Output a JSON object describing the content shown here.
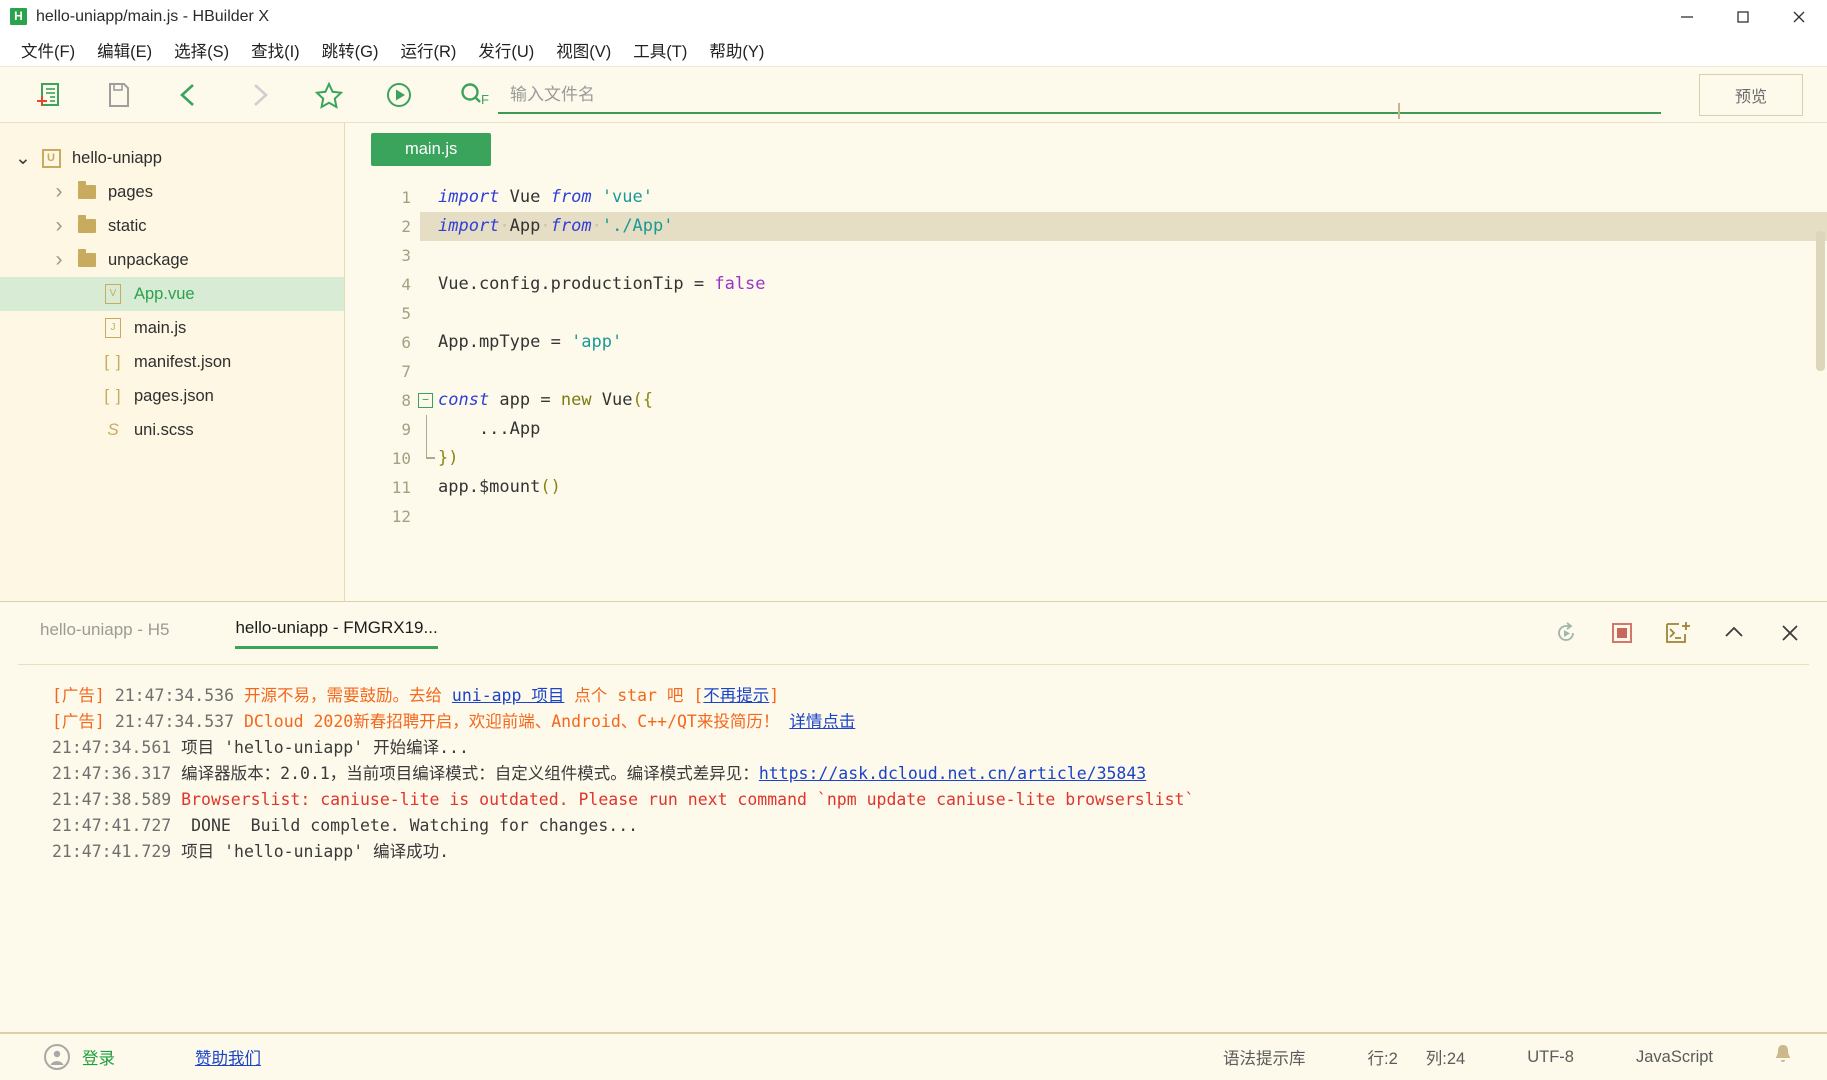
{
  "window": {
    "title": "hello-uniapp/main.js - HBuilder X",
    "logo_letter": "H",
    "minimize": "minimize-icon",
    "maximize": "maximize-icon",
    "close": "close-icon"
  },
  "menu": {
    "items": [
      {
        "label": "文件(F)",
        "name": "menu-file"
      },
      {
        "label": "编辑(E)",
        "name": "menu-edit"
      },
      {
        "label": "选择(S)",
        "name": "menu-select"
      },
      {
        "label": "查找(I)",
        "name": "menu-find"
      },
      {
        "label": "跳转(G)",
        "name": "menu-goto"
      },
      {
        "label": "运行(R)",
        "name": "menu-run"
      },
      {
        "label": "发行(U)",
        "name": "menu-publish"
      },
      {
        "label": "视图(V)",
        "name": "menu-view"
      },
      {
        "label": "工具(T)",
        "name": "menu-tools"
      },
      {
        "label": "帮助(Y)",
        "name": "menu-help"
      }
    ]
  },
  "toolbar": {
    "icons": [
      "new-file-icon",
      "save-icon",
      "back-arrow-icon",
      "forward-arrow-icon",
      "star-icon",
      "run-icon",
      "search-file-icon"
    ],
    "search_placeholder": "输入文件名",
    "search_value": "",
    "preview_label": "预览"
  },
  "filetree": {
    "items": [
      {
        "label": "hello-uniapp",
        "icon": "project-icon",
        "indent": 0,
        "chevron": "chevron-down-icon",
        "selected": false,
        "name": "tree-item-hello-uniapp"
      },
      {
        "label": "pages",
        "icon": "folder-icon",
        "indent": 1,
        "chevron": "chevron-right-icon",
        "selected": false,
        "name": "tree-item-pages"
      },
      {
        "label": "static",
        "icon": "folder-icon",
        "indent": 1,
        "chevron": "chevron-right-icon",
        "selected": false,
        "name": "tree-item-static"
      },
      {
        "label": "unpackage",
        "icon": "folder-icon",
        "indent": 1,
        "chevron": "chevron-right-icon",
        "selected": false,
        "name": "tree-item-unpackage"
      },
      {
        "label": "App.vue",
        "icon": "vue-file-icon",
        "indent": 2,
        "chevron": "",
        "selected": true,
        "name": "tree-item-app-vue"
      },
      {
        "label": "main.js",
        "icon": "js-file-icon",
        "indent": 2,
        "chevron": "",
        "selected": false,
        "name": "tree-item-main-js"
      },
      {
        "label": "manifest.json",
        "icon": "json-file-icon",
        "indent": 2,
        "chevron": "",
        "selected": false,
        "name": "tree-item-manifest-json"
      },
      {
        "label": "pages.json",
        "icon": "json-file-icon",
        "indent": 2,
        "chevron": "",
        "selected": false,
        "name": "tree-item-pages-json"
      },
      {
        "label": "uni.scss",
        "icon": "scss-file-icon",
        "indent": 2,
        "chevron": "",
        "selected": false,
        "name": "tree-item-uni-scss"
      }
    ]
  },
  "editor": {
    "tab_label": "main.js",
    "current_line": 2,
    "lines": [
      {
        "n": "1",
        "fold": "",
        "text": "import Vue from 'vue'"
      },
      {
        "n": "2",
        "fold": "",
        "text": "import App from './App'"
      },
      {
        "n": "3",
        "fold": "",
        "text": ""
      },
      {
        "n": "4",
        "fold": "",
        "text": "Vue.config.productionTip = false"
      },
      {
        "n": "5",
        "fold": "",
        "text": ""
      },
      {
        "n": "6",
        "fold": "",
        "text": "App.mpType = 'app'"
      },
      {
        "n": "7",
        "fold": "",
        "text": ""
      },
      {
        "n": "8",
        "fold": "collapse",
        "text": "const app = new Vue({"
      },
      {
        "n": "9",
        "fold": "mid",
        "text": "    ...App"
      },
      {
        "n": "10",
        "fold": "end",
        "text": "})"
      },
      {
        "n": "11",
        "fold": "",
        "text": "app.$mount()"
      },
      {
        "n": "12",
        "fold": "",
        "text": ""
      }
    ]
  },
  "console": {
    "tabs": [
      {
        "label": "hello-uniapp - H5",
        "active": false,
        "name": "console-tab-h5"
      },
      {
        "label": "hello-uniapp - FMGRX19...",
        "active": true,
        "name": "console-tab-fmgrx19"
      }
    ],
    "actions": [
      "restart-icon",
      "stop-icon",
      "new-terminal-icon",
      "chevron-up-icon",
      "close-icon"
    ],
    "logs": [
      {
        "name": "log-ad-1",
        "parts": [
          {
            "t": "[广告] ",
            "c": "ad"
          },
          {
            "t": "21:47:34.536 ",
            "c": "ts"
          },
          {
            "t": "开源不易，需要鼓励。去给 ",
            "c": "ad"
          },
          {
            "t": "uni-app 项目",
            "c": "lnk"
          },
          {
            "t": " 点个 star 吧 ",
            "c": "ad"
          },
          {
            "t": "[",
            "c": "ad"
          },
          {
            "t": "不再提示",
            "c": "lnk"
          },
          {
            "t": "]",
            "c": "ad"
          }
        ]
      },
      {
        "name": "log-ad-2",
        "parts": [
          {
            "t": "[广告] ",
            "c": "ad"
          },
          {
            "t": "21:47:34.537 ",
            "c": "ts"
          },
          {
            "t": "DCloud 2020新春招聘开启，欢迎前端、Android、C++/QT来投简历！ ",
            "c": "ad"
          },
          {
            "t": "详情点击",
            "c": "lnk"
          }
        ]
      },
      {
        "name": "log-compile-start",
        "parts": [
          {
            "t": "21:47:34.561 ",
            "c": "ts"
          },
          {
            "t": "项目 'hello-uniapp' 开始编译...",
            "c": ""
          }
        ]
      },
      {
        "name": "log-compiler-version",
        "parts": [
          {
            "t": "21:47:36.317 ",
            "c": "ts"
          },
          {
            "t": "编译器版本：2.0.1，当前项目编译模式：自定义组件模式。编译模式差异见：",
            "c": ""
          },
          {
            "t": "https://ask.dcloud.net.cn/article/35843",
            "c": "lnk"
          }
        ]
      },
      {
        "name": "log-browserslist-warning",
        "parts": [
          {
            "t": "21:47:38.589 ",
            "c": "ts"
          },
          {
            "t": "Browserslist: caniuse-lite is outdated. Please run next command `npm update caniuse-lite browserslist`",
            "c": "err"
          }
        ]
      },
      {
        "name": "log-build-done",
        "parts": [
          {
            "t": "21:47:41.727 ",
            "c": "ts"
          },
          {
            "t": " DONE  Build complete. Watching for changes...",
            "c": ""
          }
        ]
      },
      {
        "name": "log-compile-success",
        "parts": [
          {
            "t": "21:47:41.729 ",
            "c": "ts"
          },
          {
            "t": "项目 'hello-uniapp' 编译成功.",
            "c": ""
          }
        ]
      }
    ]
  },
  "statusbar": {
    "login_label": "登录",
    "sponsor_label": "赞助我们",
    "syntax_lib": "语法提示库",
    "line": "行:2",
    "column": "列:24",
    "encoding": "UTF-8",
    "language": "JavaScript",
    "bell": "bell-icon"
  },
  "colors": {
    "accent_green": "#3aa35c",
    "bg": "#fdfaec",
    "tree_bg": "#fdf7e3",
    "selected_tree": "#d8ebd4",
    "current_line": "#e5ddc4",
    "link": "#1b44c8",
    "ad_orange": "#f3681d",
    "error_red": "#e0352b"
  }
}
